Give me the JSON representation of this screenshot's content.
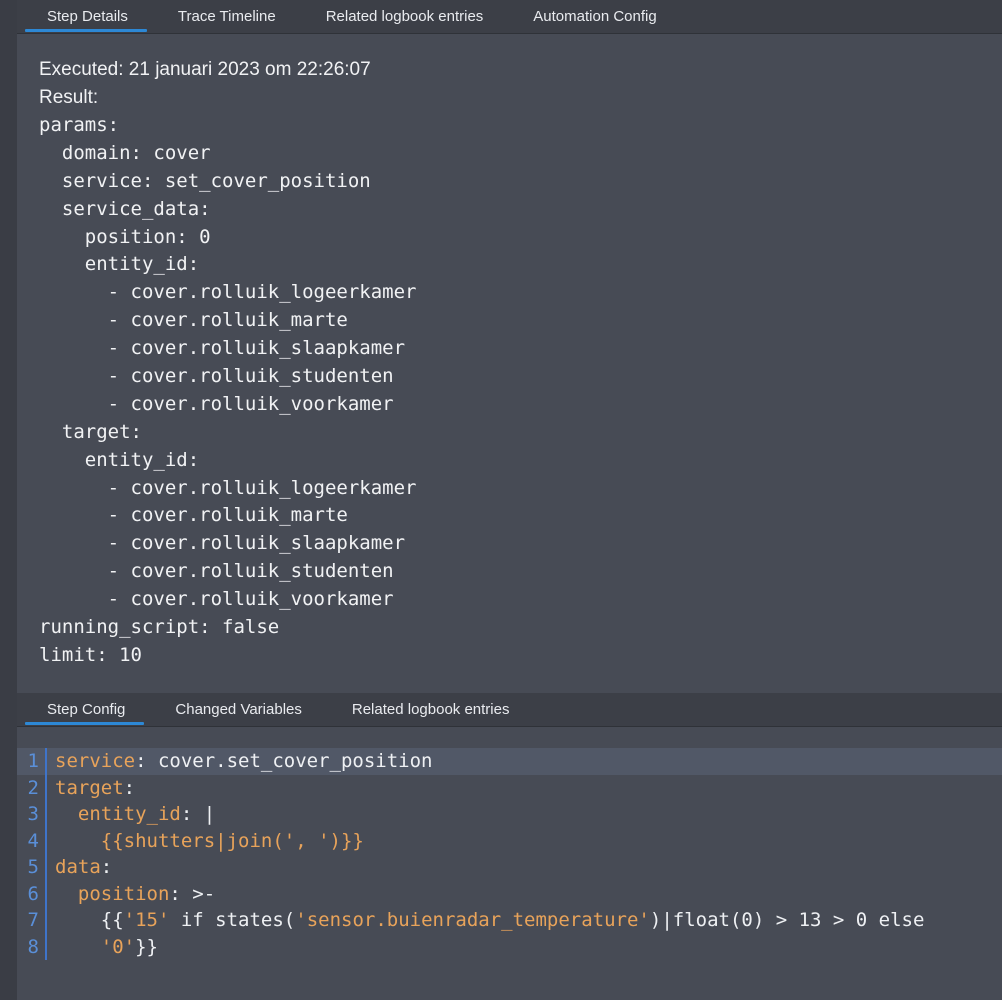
{
  "top_tabs": [
    {
      "label": "Step Details",
      "active": true
    },
    {
      "label": "Trace Timeline",
      "active": false
    },
    {
      "label": "Related logbook entries",
      "active": false
    },
    {
      "label": "Automation Config",
      "active": false
    }
  ],
  "details": {
    "executed": "Executed: 21 januari 2023 om 22:26:07",
    "result_label": "Result:",
    "yaml_lines": [
      "params:",
      "  domain: cover",
      "  service: set_cover_position",
      "  service_data:",
      "    position: 0",
      "    entity_id:",
      "      - cover.rolluik_logeerkamer",
      "      - cover.rolluik_marte",
      "      - cover.rolluik_slaapkamer",
      "      - cover.rolluik_studenten",
      "      - cover.rolluik_voorkamer",
      "  target:",
      "    entity_id:",
      "      - cover.rolluik_logeerkamer",
      "      - cover.rolluik_marte",
      "      - cover.rolluik_slaapkamer",
      "      - cover.rolluik_studenten",
      "      - cover.rolluik_voorkamer",
      "running_script: false",
      "limit: 10"
    ]
  },
  "bottom_tabs": [
    {
      "label": "Step Config",
      "active": true
    },
    {
      "label": "Changed Variables",
      "active": false
    },
    {
      "label": "Related logbook entries",
      "active": false
    }
  ],
  "editor": {
    "lines": [
      {
        "n": "1",
        "key": "service",
        "rest": ": cover.set_cover_position",
        "highlighted": true
      },
      {
        "n": "2",
        "key": "target",
        "rest": ":"
      },
      {
        "n": "3",
        "indent": "  ",
        "key": "entity_id",
        "rest": ": |"
      },
      {
        "n": "4",
        "indent": "    ",
        "str": "{{shutters|join(', ')}}"
      },
      {
        "n": "5",
        "key": "data",
        "rest": ":"
      },
      {
        "n": "6",
        "indent": "  ",
        "key": "position",
        "rest": ": >-"
      },
      {
        "n": "7",
        "indent": "    ",
        "pre": "{{",
        "str": "'15'",
        "mid": " if states(",
        "str2": "'sensor.buienradar_temperature'",
        "post": ")|float(0) > 13 > 0 else"
      },
      {
        "n": "8",
        "indent": "    ",
        "str": "'0'",
        "post": "}}"
      }
    ]
  },
  "colors": {
    "accent": "#2d88d5",
    "yaml_key": "#e8a35a",
    "line_number": "#5a8fd8"
  }
}
